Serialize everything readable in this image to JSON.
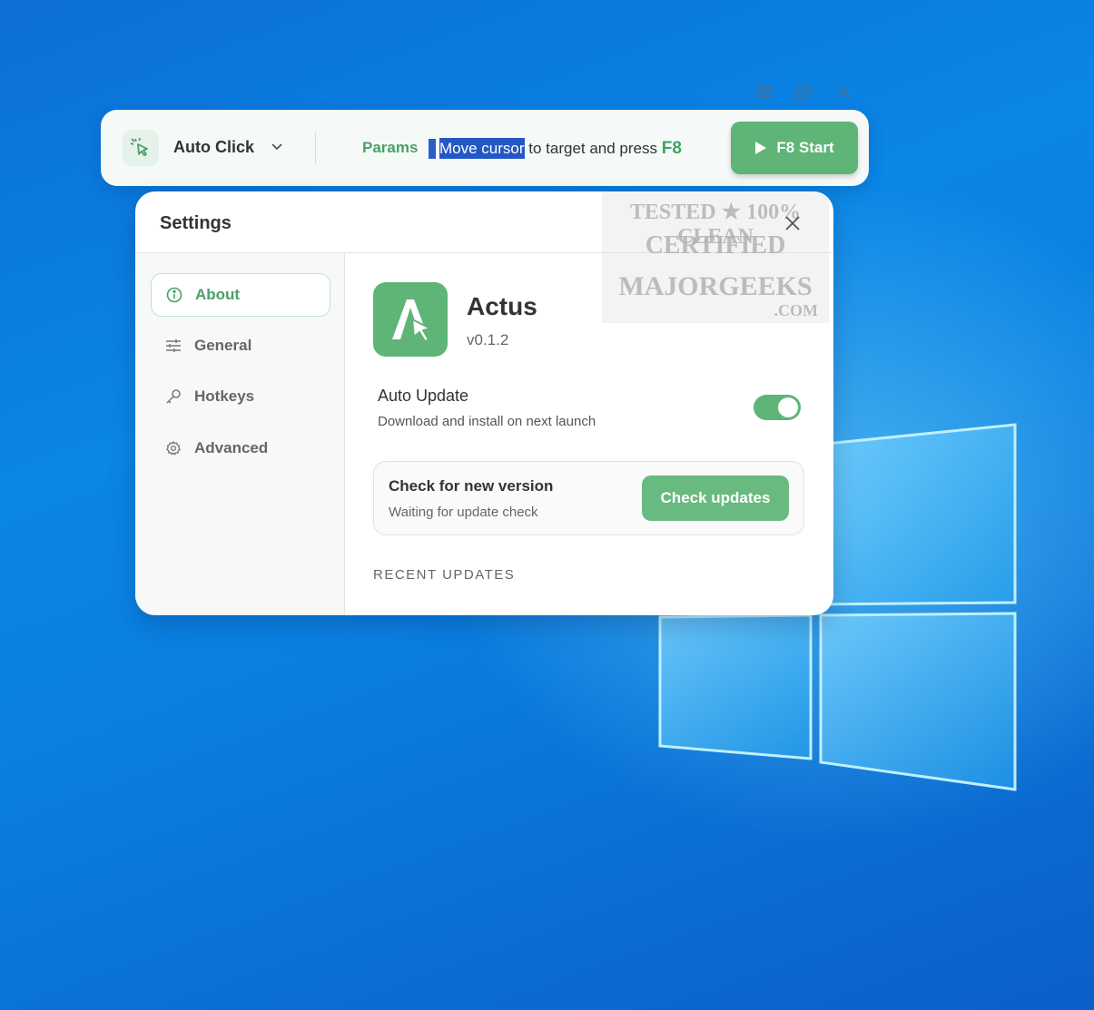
{
  "window_controls": {
    "settings_icon": "gear-icon",
    "feedback_icon": "chat-bubble-icon",
    "close_icon": "close-icon"
  },
  "toolbar": {
    "mode_icon": "pointer-click-icon",
    "mode_label": "Auto Click",
    "params_label": "Params",
    "hint_selected": "Move cursor",
    "hint_rest": " to target and press ",
    "hint_key": "F8",
    "start_label": "F8 Start"
  },
  "settings": {
    "title": "Settings",
    "nav": [
      {
        "label": "About",
        "icon": "info-icon",
        "active": true
      },
      {
        "label": "General",
        "icon": "sliders-icon",
        "active": false
      },
      {
        "label": "Hotkeys",
        "icon": "key-icon",
        "active": false
      },
      {
        "label": "Advanced",
        "icon": "gear-icon",
        "active": false
      }
    ],
    "about": {
      "app_name": "Actus",
      "version": "v0.1.2",
      "auto_update_title": "Auto Update",
      "auto_update_desc": "Download and install on next launch",
      "auto_update_enabled": true,
      "check_title": "Check for new version",
      "check_status": "Waiting for update check",
      "check_button": "Check updates",
      "recent_updates_heading": "RECENT UPDATES"
    }
  },
  "watermark": {
    "line1": "TESTED ★ 100% CLEAN",
    "line2": "CERTIFIED",
    "line3": "MAJORGEEKS",
    "line4": ".COM"
  },
  "colors": {
    "accent_green": "#5fb478",
    "desktop_blue": "#0a86e6"
  }
}
